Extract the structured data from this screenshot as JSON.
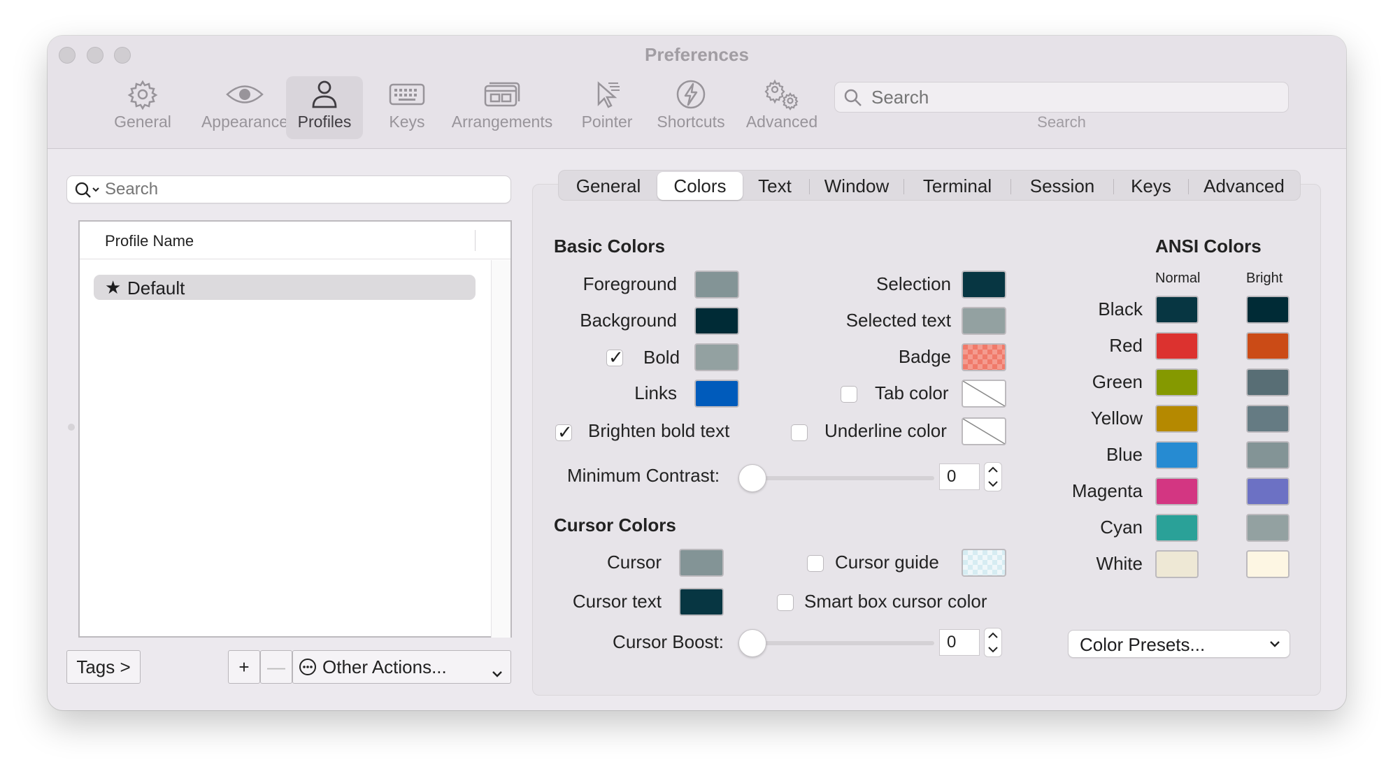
{
  "window": {
    "title": "Preferences"
  },
  "toolbar": {
    "items": [
      {
        "label": "General",
        "icon": "gear-icon"
      },
      {
        "label": "Appearance",
        "icon": "eye-icon"
      },
      {
        "label": "Profiles",
        "icon": "person-icon",
        "active": true
      },
      {
        "label": "Keys",
        "icon": "keyboard-icon"
      },
      {
        "label": "Arrangements",
        "icon": "windows-icon"
      },
      {
        "label": "Pointer",
        "icon": "pointer-icon"
      },
      {
        "label": "Shortcuts",
        "icon": "bolt-icon"
      },
      {
        "label": "Advanced",
        "icon": "gears-icon"
      }
    ],
    "search_placeholder": "Search",
    "search_label": "Search"
  },
  "profiles": {
    "search_placeholder": "Search",
    "column_header": "Profile Name",
    "rows": [
      {
        "name": "Default",
        "default": true
      }
    ],
    "tags_button": "Tags >",
    "add_button": "+",
    "remove_button": "—",
    "other_actions": "Other Actions..."
  },
  "tabs": [
    "General",
    "Colors",
    "Text",
    "Window",
    "Terminal",
    "Session",
    "Keys",
    "Advanced"
  ],
  "active_tab": "Colors",
  "basic_colors": {
    "heading": "Basic Colors",
    "foreground": {
      "label": "Foreground",
      "color": "#839496"
    },
    "background": {
      "label": "Background",
      "color": "#002b36"
    },
    "bold": {
      "label": "Bold",
      "checked": true,
      "color": "#93a1a1"
    },
    "links": {
      "label": "Links",
      "color": "#005bbb"
    },
    "selection": {
      "label": "Selection",
      "color": "#073642"
    },
    "selected_text": {
      "label": "Selected text",
      "color": "#93a1a1"
    },
    "badge": {
      "label": "Badge",
      "color": "#f07a6a"
    },
    "tab_color": {
      "label": "Tab color",
      "checked": false
    },
    "brighten_bold": {
      "label": "Brighten bold text",
      "checked": true
    },
    "underline_color": {
      "label": "Underline color",
      "checked": false
    },
    "min_contrast": {
      "label": "Minimum Contrast:",
      "value": "0"
    }
  },
  "cursor_colors": {
    "heading": "Cursor Colors",
    "cursor": {
      "label": "Cursor",
      "color": "#839496"
    },
    "cursor_text": {
      "label": "Cursor text",
      "color": "#073642"
    },
    "cursor_guide": {
      "label": "Cursor guide",
      "checked": false,
      "color": "#d6ecf2"
    },
    "smart_box": {
      "label": "Smart box cursor color",
      "checked": false
    },
    "cursor_boost": {
      "label": "Cursor Boost:",
      "value": "0"
    }
  },
  "ansi": {
    "heading": "ANSI Colors",
    "normal_label": "Normal",
    "bright_label": "Bright",
    "rows": [
      {
        "name": "Black",
        "normal": "#073642",
        "bright": "#002b36"
      },
      {
        "name": "Red",
        "normal": "#dc322f",
        "bright": "#cb4b16"
      },
      {
        "name": "Green",
        "normal": "#859900",
        "bright": "#586e75"
      },
      {
        "name": "Yellow",
        "normal": "#b58900",
        "bright": "#657b83"
      },
      {
        "name": "Blue",
        "normal": "#268bd2",
        "bright": "#839496"
      },
      {
        "name": "Magenta",
        "normal": "#d33682",
        "bright": "#6c71c4"
      },
      {
        "name": "Cyan",
        "normal": "#2aa198",
        "bright": "#93a1a1"
      },
      {
        "name": "White",
        "normal": "#eee8d5",
        "bright": "#fdf6e3"
      }
    ],
    "presets_label": "Color Presets..."
  }
}
